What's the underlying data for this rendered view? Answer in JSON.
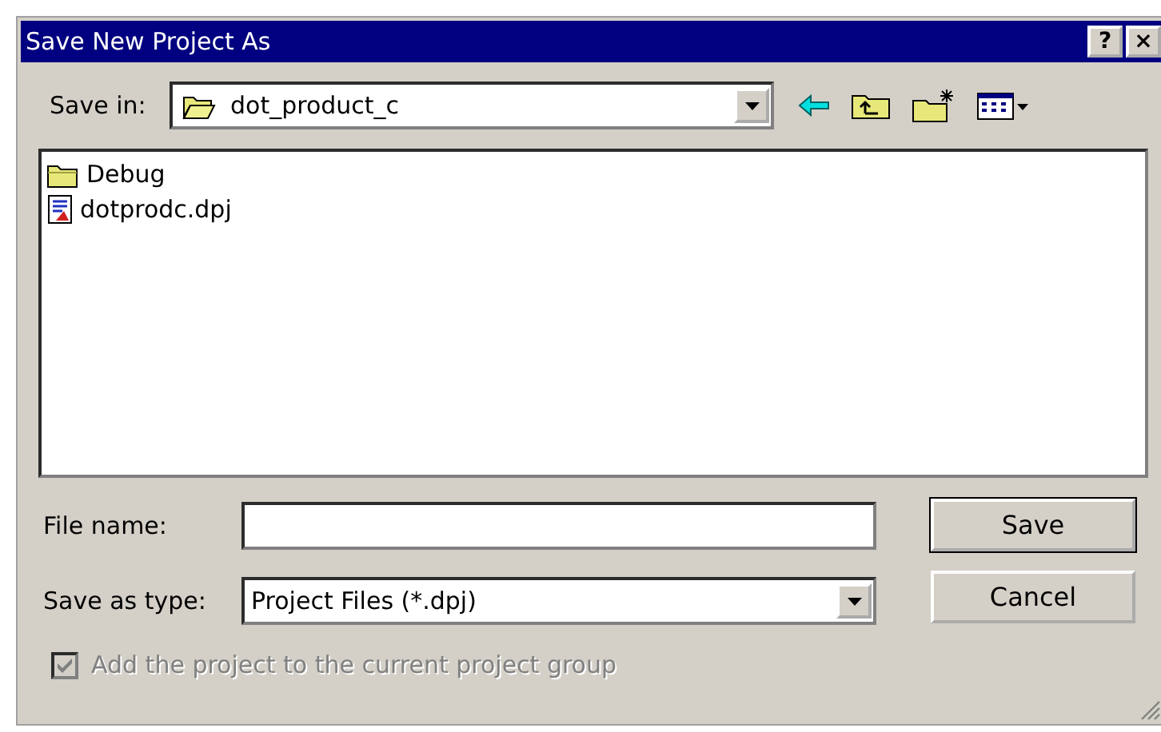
{
  "window": {
    "title": "Save New Project As",
    "title_buttons": [
      "?",
      "×"
    ]
  },
  "save_in": {
    "label": "Save in:",
    "value": "dot_product_c"
  },
  "files": [
    {
      "name": "Debug",
      "kind": "folder"
    },
    {
      "name": "dotprodc.dpj",
      "kind": "project"
    }
  ],
  "file_name": {
    "label": "File name:"
  },
  "save_as_type": {
    "label": "Save as type:",
    "value": "Project Files (*.dpj)"
  },
  "buttons": [
    "Save",
    "Cancel"
  ],
  "add_to_group": {
    "label": "Add the project to the current project group",
    "checked": true,
    "disabled": true
  }
}
